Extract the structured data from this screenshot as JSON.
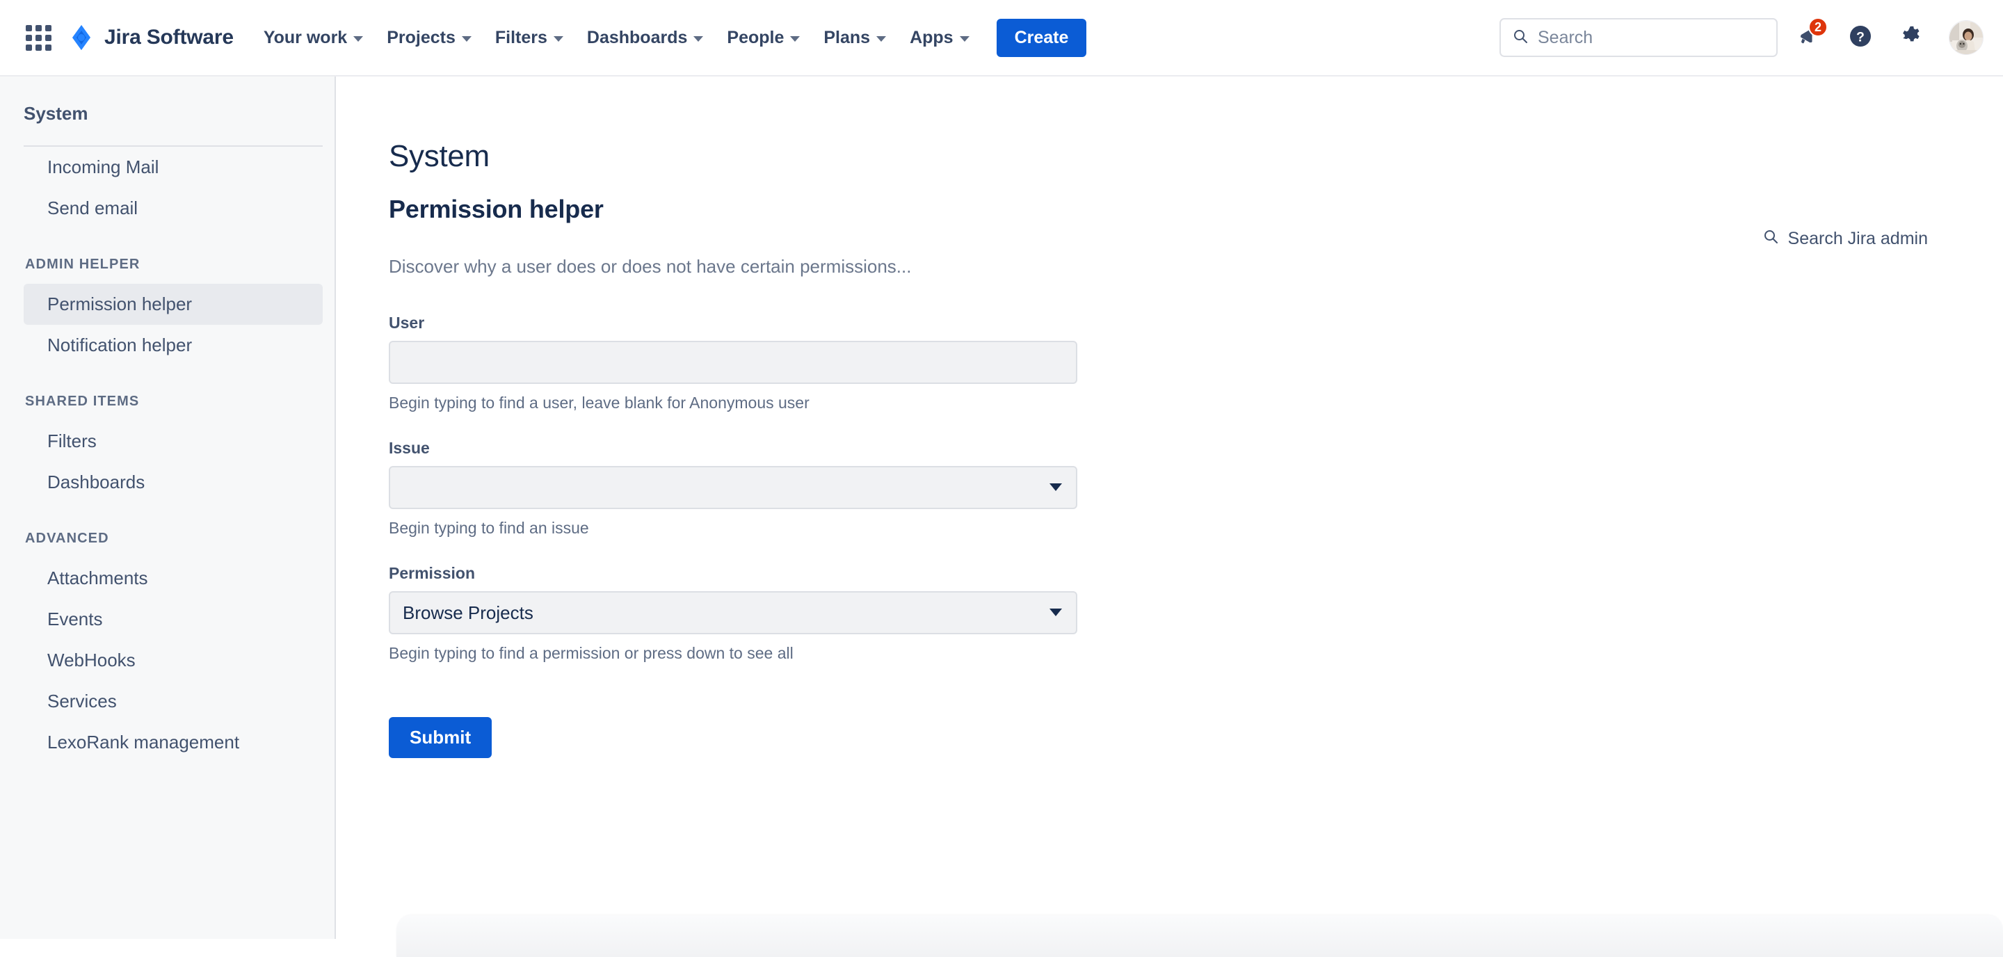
{
  "topnav": {
    "app_switcher_icon": "grid-apps-icon",
    "brand": {
      "logo_icon": "jira-diamond-logo",
      "name": "Jira Software"
    },
    "items": [
      {
        "label": "Your work",
        "has_caret": true
      },
      {
        "label": "Projects",
        "has_caret": true
      },
      {
        "label": "Filters",
        "has_caret": true
      },
      {
        "label": "Dashboards",
        "has_caret": true
      },
      {
        "label": "People",
        "has_caret": true
      },
      {
        "label": "Plans",
        "has_caret": true
      },
      {
        "label": "Apps",
        "has_caret": true
      }
    ],
    "create_label": "Create",
    "search": {
      "placeholder": "Search",
      "value": "",
      "icon": "search-icon"
    },
    "notifications": {
      "icon": "megaphone-icon",
      "badge_count": "2"
    },
    "help": {
      "icon": "help-circle-icon"
    },
    "settings": {
      "icon": "gear-icon"
    },
    "avatar": {
      "icon": "user-avatar"
    }
  },
  "sidebar": {
    "title": "System",
    "items_top": [
      {
        "label": "Incoming Mail",
        "active": false
      },
      {
        "label": "Send email",
        "active": false
      }
    ],
    "groups": [
      {
        "label": "ADMIN HELPER",
        "items": [
          {
            "label": "Permission helper",
            "active": true
          },
          {
            "label": "Notification helper",
            "active": false
          }
        ]
      },
      {
        "label": "SHARED ITEMS",
        "items": [
          {
            "label": "Filters",
            "active": false
          },
          {
            "label": "Dashboards",
            "active": false
          }
        ]
      },
      {
        "label": "ADVANCED",
        "items": [
          {
            "label": "Attachments",
            "active": false
          },
          {
            "label": "Events",
            "active": false
          },
          {
            "label": "WebHooks",
            "active": false
          },
          {
            "label": "Services",
            "active": false
          },
          {
            "label": "LexoRank management",
            "active": false
          }
        ]
      }
    ]
  },
  "main": {
    "admin_search": {
      "label": "Search Jira admin",
      "icon": "search-icon"
    },
    "page_title": "System",
    "section_title": "Permission helper",
    "description": "Discover why a user does or does not have certain permissions...",
    "form": {
      "user": {
        "label": "User",
        "value": "",
        "placeholder": "",
        "help": "Begin typing to find a user, leave blank for Anonymous user"
      },
      "issue": {
        "label": "Issue",
        "value": "",
        "help": "Begin typing to find an issue",
        "caret_icon": "chevron-down-icon"
      },
      "permission": {
        "label": "Permission",
        "value": "Browse Projects",
        "help": "Begin typing to find a permission or press down to see all",
        "caret_icon": "chevron-down-icon"
      },
      "submit_label": "Submit"
    }
  },
  "colors": {
    "brand_blue": "#0B5CD5",
    "text_dark": "#172B4D",
    "text_muted": "#6B778C",
    "sidebar_bg": "#F7F8F9",
    "active_item_bg": "#E8EAEE",
    "badge_red": "#DE350B",
    "field_bg": "#F1F2F4"
  }
}
